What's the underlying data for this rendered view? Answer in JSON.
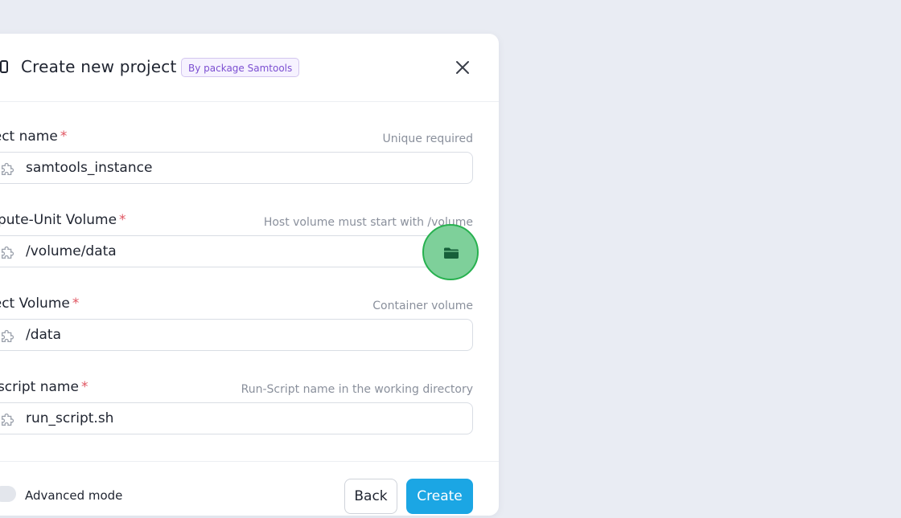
{
  "background": {
    "text": ""
  },
  "modal": {
    "title": "Create new project",
    "badge": "By package Samtools"
  },
  "fields": [
    {
      "label": "roject name",
      "hint": "Unique required",
      "value": "samtools_instance"
    },
    {
      "label": "ompute-Unit Volume",
      "hint": "Host volume must start with /volume",
      "value": "/volume/data"
    },
    {
      "label": "roject Volume",
      "hint": "Container volume",
      "value": "/data"
    },
    {
      "label": "un script name",
      "hint": "Run-Script name in the working directory",
      "value": "run_script.sh"
    }
  ],
  "required_mark": "*",
  "footer": {
    "advanced_label": "Advanced mode",
    "back_label": "Back",
    "create_label": "Create"
  },
  "icons": {
    "header": "project-icon",
    "close": "close-icon",
    "field": "puzzle-icon",
    "browse": "folder-icon"
  },
  "colors": {
    "accent": "#1ba6e4",
    "required": "#e05561",
    "badge": "#7c4fd1",
    "highlight": "#27b14f"
  }
}
